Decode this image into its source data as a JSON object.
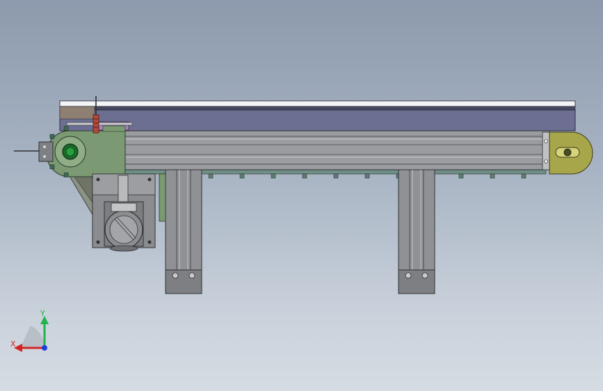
{
  "viewport": {
    "background_top": "#8d9aad",
    "background_bottom": "#d6dce3"
  },
  "model": {
    "name_plate_text": "",
    "motor_label": "",
    "colors": {
      "belt_top": "#f2f4f7",
      "belt_body": "#6c6f92",
      "belt_edge": "#45485f",
      "frame": "#9a9c9f",
      "frame_dark": "#5e6063",
      "drive_plate": "#7b9a73",
      "tail_plate": "#a8a64a",
      "leg": "#8f9194",
      "motor": "#8a8c8f",
      "tensioner": "#7c8487",
      "sensor": "#b24a3a",
      "bracket": "#a97fc0"
    }
  },
  "triad": {
    "x_label": "X",
    "y_label": "Y",
    "x_color": "#d42424",
    "y_color": "#22b14c",
    "z_color": "#1f3fd8"
  }
}
